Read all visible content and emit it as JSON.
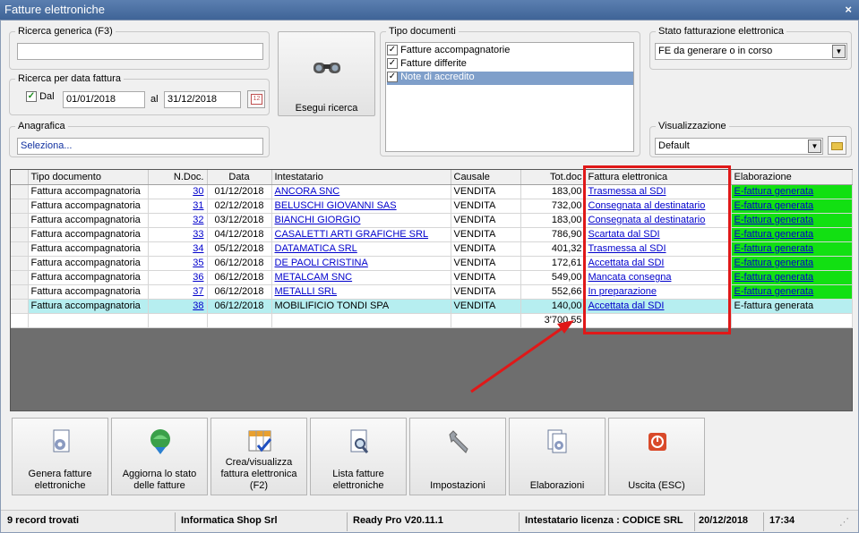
{
  "window": {
    "title": "Fatture elettroniche",
    "close": "×"
  },
  "search": {
    "generic_label": "Ricerca generica (F3)",
    "generic_value": "",
    "date_label": "Ricerca per data fattura",
    "dal_label": "Dal",
    "dal_checked": "✓",
    "from": "01/01/2018",
    "al_label": "al",
    "to": "31/12/2018",
    "calendar_text": "12"
  },
  "anagrafica": {
    "label": "Anagrafica",
    "value": "Seleziona..."
  },
  "esegui": {
    "label": "Esegui ricerca"
  },
  "tipo_documenti": {
    "label": "Tipo documenti",
    "items": [
      {
        "label": "Fatture accompagnatorie",
        "check": "✓"
      },
      {
        "label": "Fatture differite",
        "check": "✓"
      },
      {
        "label": "Note di accredito",
        "check": "✓"
      }
    ]
  },
  "stato": {
    "label": "Stato fatturazione elettronica",
    "value": "FE da generare o in corso"
  },
  "visualizzazione": {
    "label": "Visualizzazione",
    "value": "Default"
  },
  "grid": {
    "headers": [
      "Tipo documento",
      "N.Doc.",
      "Data",
      "Intestatario",
      "Causale",
      "Tot.doc",
      "Fattura elettronica",
      "Elaborazione"
    ],
    "rows": [
      {
        "tipo": "Fattura accompagnatoria",
        "ndoc": "30",
        "data": "01/12/2018",
        "intestatario": "ANCORA SNC",
        "causale": "VENDITA",
        "tot": "183,00",
        "fe": "Trasmessa al SDI",
        "elab": "E-fattura generata"
      },
      {
        "tipo": "Fattura accompagnatoria",
        "ndoc": "31",
        "data": "02/12/2018",
        "intestatario": "BELUSCHI GIOVANNI SAS",
        "causale": "VENDITA",
        "tot": "732,00",
        "fe": "Consegnata al destinatario",
        "elab": "E-fattura generata"
      },
      {
        "tipo": "Fattura accompagnatoria",
        "ndoc": "32",
        "data": "03/12/2018",
        "intestatario": "BIANCHI GIORGIO",
        "causale": "VENDITA",
        "tot": "183,00",
        "fe": "Consegnata al destinatario",
        "elab": "E-fattura generata"
      },
      {
        "tipo": "Fattura accompagnatoria",
        "ndoc": "33",
        "data": "04/12/2018",
        "intestatario": "CASALETTI ARTI GRAFICHE SRL",
        "causale": "VENDITA",
        "tot": "786,90",
        "fe": "Scartata dal SDI",
        "elab": "E-fattura generata"
      },
      {
        "tipo": "Fattura accompagnatoria",
        "ndoc": "34",
        "data": "05/12/2018",
        "intestatario": "DATAMATICA SRL",
        "causale": "VENDITA",
        "tot": "401,32",
        "fe": "Trasmessa al SDI",
        "elab": "E-fattura generata"
      },
      {
        "tipo": "Fattura accompagnatoria",
        "ndoc": "35",
        "data": "06/12/2018",
        "intestatario": "DE PAOLI CRISTINA",
        "causale": "VENDITA",
        "tot": "172,61",
        "fe": "Accettata dal SDI",
        "elab": "E-fattura generata"
      },
      {
        "tipo": "Fattura accompagnatoria",
        "ndoc": "36",
        "data": "06/12/2018",
        "intestatario": "METALCAM SNC",
        "causale": "VENDITA",
        "tot": "549,00",
        "fe": "Mancata consegna",
        "elab": "E-fattura generata"
      },
      {
        "tipo": "Fattura accompagnatoria",
        "ndoc": "37",
        "data": "06/12/2018",
        "intestatario": "METALLI SRL",
        "causale": "VENDITA",
        "tot": "552,66",
        "fe": "In preparazione",
        "elab": "E-fattura generata"
      },
      {
        "tipo": "Fattura accompagnatoria",
        "ndoc": "38",
        "data": "06/12/2018",
        "intestatario": "MOBILIFICIO TONDI SPA",
        "causale": "VENDITA",
        "tot": "140,00",
        "fe": "Accettata dal SDI",
        "elab": "E-fattura generata"
      }
    ],
    "total": "3'700,55"
  },
  "toolbar": [
    {
      "label": "Genera fatture elettroniche",
      "icon": "gear-document-icon"
    },
    {
      "label": "Aggiorna lo stato delle fatture",
      "icon": "globe-refresh-icon"
    },
    {
      "label": "Crea/visualizza fattura elettronica (F2)",
      "icon": "grid-check-icon"
    },
    {
      "label": "Lista fatture elettroniche",
      "icon": "document-search-icon"
    },
    {
      "label": "Impostazioni",
      "icon": "wrench-icon"
    },
    {
      "label": "Elaborazioni",
      "icon": "gear-documents-icon"
    },
    {
      "label": "Uscita (ESC)",
      "icon": "power-icon"
    }
  ],
  "status": {
    "records": "9 record trovati",
    "company": "Informatica Shop Srl",
    "version": "Ready Pro V20.11.1",
    "license": "Intestatario licenza : CODICE SRL",
    "date": "20/12/2018",
    "time": "17:34"
  },
  "colors": {
    "elab_green": "#12e012",
    "selected_row": "#b6eef0",
    "annotation_red": "#e01818",
    "link_blue": "#0000cc"
  }
}
